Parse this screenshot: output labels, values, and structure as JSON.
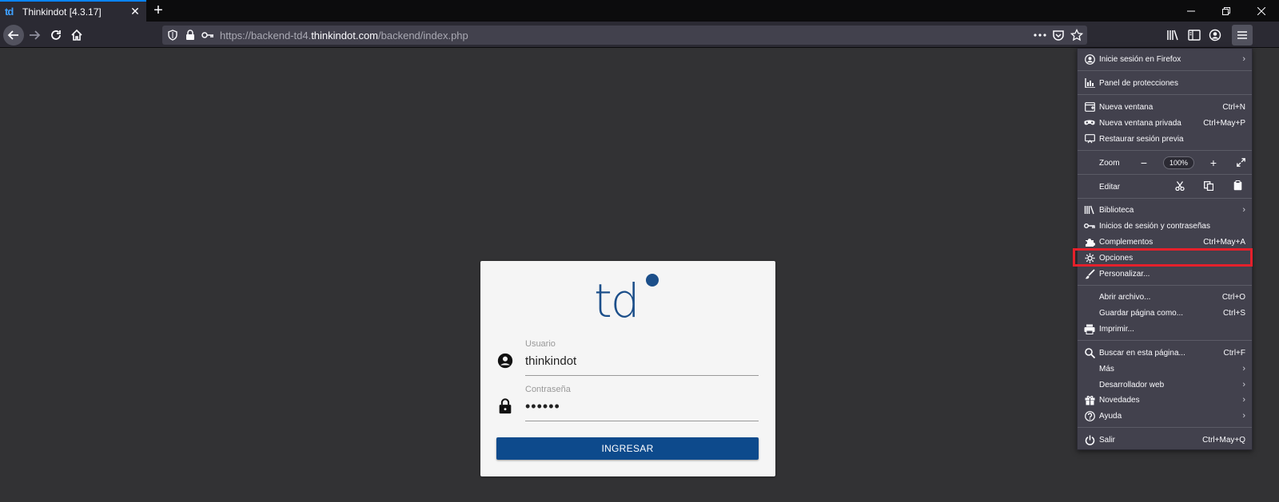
{
  "browser": {
    "tab": {
      "title": "Thinkindot [4.3.17]",
      "favicon": "td"
    },
    "url": {
      "prefix": "https://backend-td4.",
      "domain": "thinkindot.com",
      "suffix": "/backend/index.php"
    }
  },
  "login": {
    "logo_text": "td",
    "username": {
      "label": "Usuario",
      "value": "thinkindot"
    },
    "password": {
      "label": "Contraseña",
      "value": "••••••"
    },
    "submit_label": "INGRESAR"
  },
  "menu": {
    "signin": "Inicie sesión en Firefox",
    "protections": "Panel de protecciones",
    "new_window": {
      "label": "Nueva ventana",
      "key": "Ctrl+N"
    },
    "private_window": {
      "label": "Nueva ventana privada",
      "key": "Ctrl+May+P"
    },
    "restore": "Restaurar sesión previa",
    "zoom": {
      "label": "Zoom",
      "minus": "−",
      "value": "100%",
      "plus": "+"
    },
    "edit": {
      "label": "Editar"
    },
    "library": "Biblioteca",
    "logins": "Inicios de sesión y contraseñas",
    "addons": {
      "label": "Complementos",
      "key": "Ctrl+May+A"
    },
    "options": "Opciones",
    "customize": "Personalizar...",
    "open_file": {
      "label": "Abrir archivo...",
      "key": "Ctrl+O"
    },
    "save_page": {
      "label": "Guardar página como...",
      "key": "Ctrl+S"
    },
    "print": "Imprimir...",
    "find": {
      "label": "Buscar en esta página...",
      "key": "Ctrl+F"
    },
    "more": "Más",
    "webdev": "Desarrollador web",
    "whatsnew": "Novedades",
    "help": "Ayuda",
    "quit": {
      "label": "Salir",
      "key": "Ctrl+May+Q"
    }
  },
  "colors": {
    "accent": "#0a84ff",
    "brand": "#1c4f8a",
    "button": "#0d4a8c",
    "highlight": "#e5202b"
  }
}
